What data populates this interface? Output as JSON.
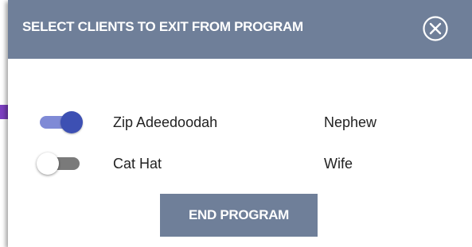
{
  "dialog": {
    "title": "SELECT CLIENTS TO EXIT FROM PROGRAM",
    "close_icon": "close-circle-icon"
  },
  "clients": [
    {
      "name": "Zip Adeedoodah",
      "relation": "Nephew",
      "selected": true
    },
    {
      "name": "Cat Hat",
      "relation": "Wife",
      "selected": false
    }
  ],
  "actions": {
    "end_program_label": "END PROGRAM"
  },
  "colors": {
    "header": "#6f7f99",
    "toggle_on_thumb": "#3d50b3",
    "toggle_on_track": "#7f8ad6",
    "toggle_off_track": "#7a7a7a",
    "pointer_arrow": "#7b3fbf"
  }
}
